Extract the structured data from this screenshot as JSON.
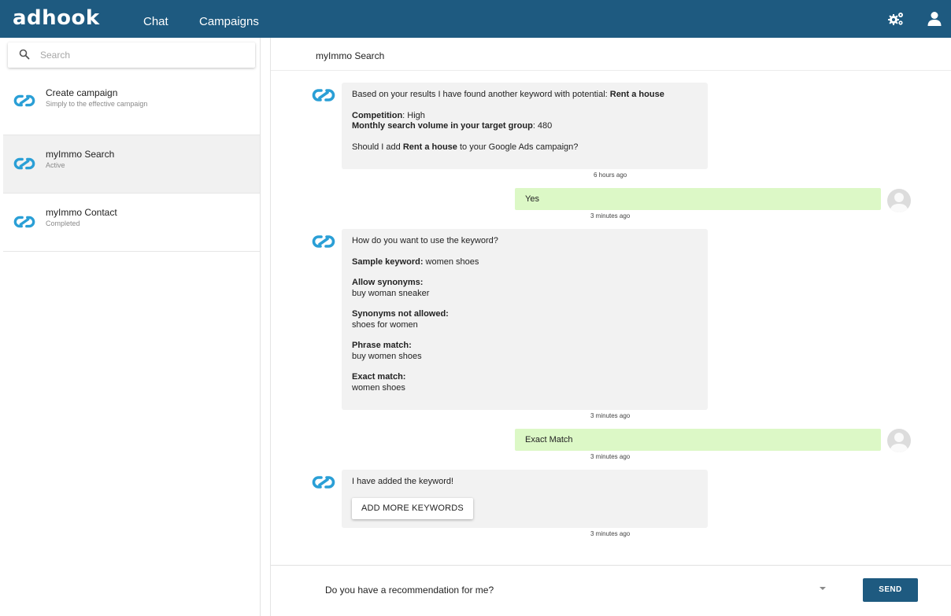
{
  "app": {
    "logo": "adhook",
    "nav": {
      "chat": "Chat",
      "campaigns": "Campaigns"
    },
    "colors": {
      "primary": "#1e5a80",
      "accent": "#2a9fd6",
      "user_bubble": "#dcf8c6",
      "bot_bubble": "#f2f2f2"
    },
    "icons": {
      "settings": "gears-icon",
      "account": "user-icon",
      "bot": "chain-link-icon"
    }
  },
  "sidebar": {
    "search_placeholder": "Search",
    "items": [
      {
        "title": "Create campaign",
        "subtitle": "Simply to the effective campaign"
      },
      {
        "title": "myImmo Search",
        "subtitle": "Active"
      },
      {
        "title": "myImmo Contact",
        "subtitle": "Completed"
      }
    ]
  },
  "main": {
    "title": "myImmo Search",
    "messages": {
      "m1": {
        "line1_prefix": "Based on your results I have found another keyword with potential: ",
        "line1_bold": "Rent a house",
        "competition_label": "Competition",
        "competition_value": ": High",
        "volume_label": "Monthly search volume in your target group",
        "volume_value": ": 480",
        "q_prefix": "Should I add ",
        "q_bold": "Rent a house",
        "q_suffix": " to your Google Ads campaign?",
        "time": "6 hours ago"
      },
      "u1": {
        "text": "Yes",
        "time": "3 minutes ago"
      },
      "m2": {
        "intro": "How do you want to use the keyword?",
        "sample_label": "Sample keyword:",
        "sample_value": " women shoes",
        "syn_label": "Allow synonyms:",
        "syn_value": "buy woman sneaker",
        "nosyn_label": "Synonyms not allowed:",
        "nosyn_value": "shoes for women",
        "phrase_label": "Phrase match:",
        "phrase_value": "buy women shoes",
        "exact_label": "Exact match:",
        "exact_value": "women shoes",
        "time": "3 minutes ago"
      },
      "u2": {
        "text": "Exact Match",
        "time": "3 minutes ago"
      },
      "m3": {
        "text": "I have added the keyword!",
        "button": "ADD MORE KEYWORDS",
        "time": "3 minutes ago"
      }
    }
  },
  "composer": {
    "value": "Do you have a recommendation for me?",
    "send": "SEND"
  }
}
